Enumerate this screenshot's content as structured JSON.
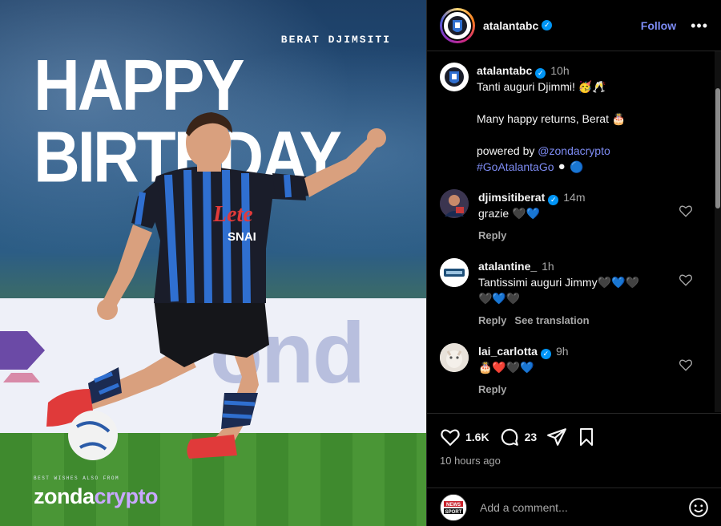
{
  "post_image": {
    "subtitle": "BERAT DJIMSITI",
    "headline": "HAPPY BIRTHDAY",
    "board_word": "ond",
    "sponsor_note": "BEST WISHES ALSO FROM",
    "sponsor_brand_a": "zonda",
    "sponsor_brand_b": "crypto",
    "shirt_text": "Lete",
    "shirt_sub": "SNAI"
  },
  "header": {
    "username": "atalantabc",
    "follow_label": "Follow",
    "more_label": "•••"
  },
  "caption": {
    "username": "atalantabc",
    "time": "10h",
    "line1": "Tanti auguri Djimmi! 🥳🥂",
    "line2": "Many happy returns, Berat 🎂",
    "line3_prefix": "powered by ",
    "mention": "@zondacrypto",
    "hashtag": "#GoAtalantaGo",
    "line4_suffix": " ⚫ 🔵"
  },
  "comments": [
    {
      "username": "djimsitiberat",
      "verified": true,
      "time": "14m",
      "text": "grazie 🖤💙",
      "reply_label": "Reply",
      "translate_label": ""
    },
    {
      "username": "atalantine_",
      "verified": false,
      "time": "1h",
      "text": "Tantissimi auguri Jimmy🖤💙🖤",
      "text2": "🖤💙🖤",
      "reply_label": "Reply",
      "translate_label": "See translation"
    },
    {
      "username": "lai_carlotta",
      "verified": true,
      "time": "9h",
      "text": "🎂❤️🖤💙",
      "reply_label": "Reply",
      "translate_label": ""
    }
  ],
  "actions": {
    "likes": "1.6K",
    "comments": "23",
    "posted": "10 hours ago"
  },
  "add_comment": {
    "placeholder": "Add a comment...",
    "avatar_text": "NEWS SPORT"
  }
}
